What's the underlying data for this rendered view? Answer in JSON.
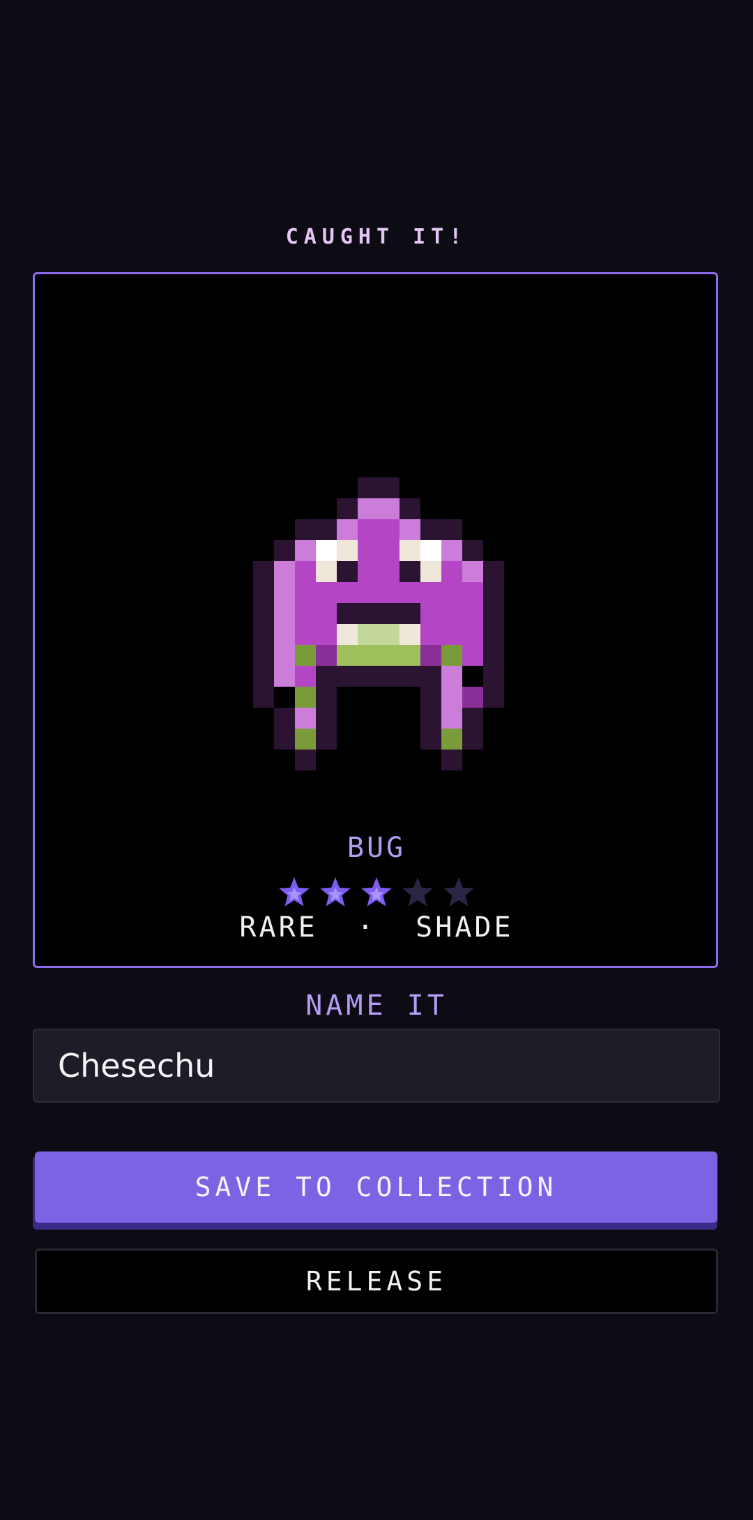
{
  "header": {
    "title": "CAUGHT IT!"
  },
  "creature": {
    "type": "BUG",
    "rarity": "RARE",
    "separator": "·",
    "variant": "SHADE",
    "stars_filled": 3,
    "stars_total": 5,
    "icon": "pixel-bug-creature"
  },
  "naming": {
    "label": "NAME IT",
    "value": "Chesechu"
  },
  "actions": {
    "save_label": "SAVE TO COLLECTION",
    "release_label": "RELEASE"
  },
  "colors": {
    "background": "#0d0b14",
    "accent": "#7e62e4",
    "card_border": "#8e6cf0",
    "label": "#b49cf4",
    "title": "#e4c8f4",
    "star_filled": "#7e5cf0",
    "star_empty": "#2a2545"
  }
}
